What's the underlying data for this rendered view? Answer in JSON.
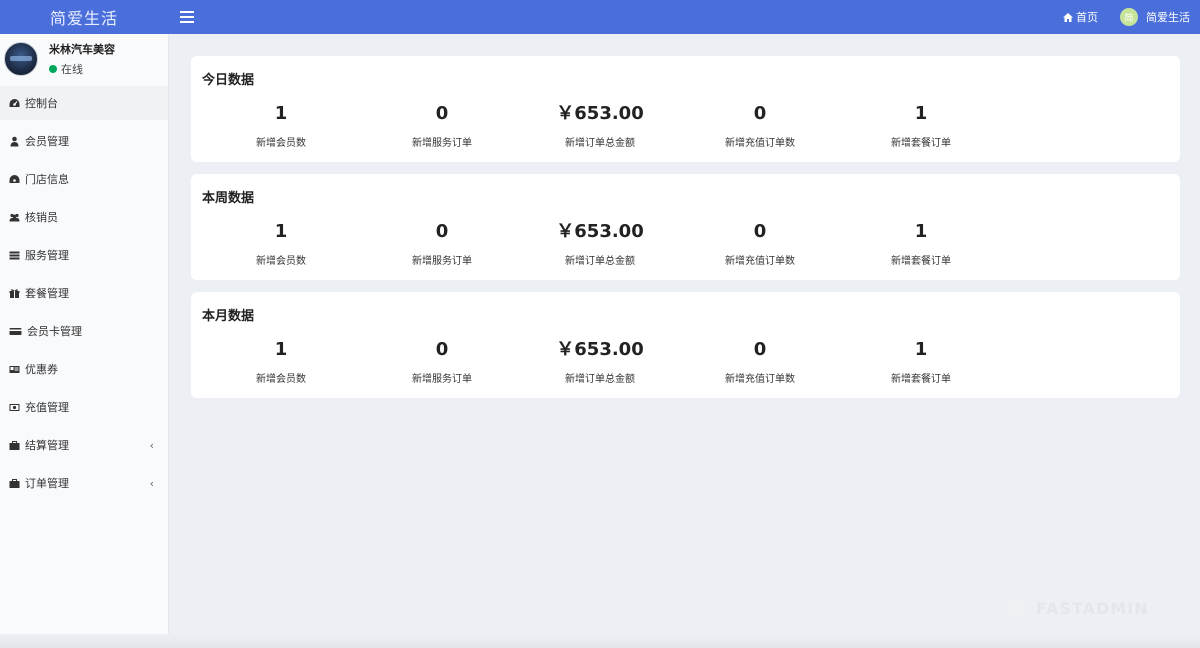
{
  "header": {
    "brand": "简爱生活",
    "home_label": "首页",
    "user_label": "简爱生活",
    "avatar_text": "简"
  },
  "user_panel": {
    "name": "米林汽车美容",
    "status": "在线"
  },
  "sidebar": {
    "items": [
      {
        "label": "控制台",
        "icon": "dashboard-icon"
      },
      {
        "label": "会员管理",
        "icon": "user-icon"
      },
      {
        "label": "门店信息",
        "icon": "store-icon"
      },
      {
        "label": "核销员",
        "icon": "users-icon"
      },
      {
        "label": "服务管理",
        "icon": "list-icon"
      },
      {
        "label": "套餐管理",
        "icon": "gift-icon"
      },
      {
        "label": "会员卡管理",
        "icon": "credit-card-icon"
      },
      {
        "label": "优惠券",
        "icon": "coupon-icon"
      },
      {
        "label": "充值管理",
        "icon": "money-icon"
      },
      {
        "label": "结算管理",
        "icon": "briefcase-icon"
      },
      {
        "label": "订单管理",
        "icon": "briefcase-icon"
      }
    ]
  },
  "cards": [
    {
      "title": "今日数据",
      "stats": [
        {
          "value": "1",
          "label": "新增会员数"
        },
        {
          "value": "0",
          "label": "新增服务订单"
        },
        {
          "value": "￥653.00",
          "label": "新增订单总金额"
        },
        {
          "value": "0",
          "label": "新增充值订单数"
        },
        {
          "value": "1",
          "label": "新增套餐订单"
        }
      ]
    },
    {
      "title": "本周数据",
      "stats": [
        {
          "value": "1",
          "label": "新增会员数"
        },
        {
          "value": "0",
          "label": "新增服务订单"
        },
        {
          "value": "￥653.00",
          "label": "新增订单总金额"
        },
        {
          "value": "0",
          "label": "新增充值订单数"
        },
        {
          "value": "1",
          "label": "新增套餐订单"
        }
      ]
    },
    {
      "title": "本月数据",
      "stats": [
        {
          "value": "1",
          "label": "新增会员数"
        },
        {
          "value": "0",
          "label": "新增服务订单"
        },
        {
          "value": "￥653.00",
          "label": "新增订单总金额"
        },
        {
          "value": "0",
          "label": "新增充值订单数"
        },
        {
          "value": "1",
          "label": "新增套餐订单"
        }
      ]
    }
  ],
  "watermark": "FASTADMIN",
  "colors": {
    "topbar": "#4a6fdb",
    "sidebar_bg": "#f9fafc",
    "content_bg": "#ecf0f5",
    "status_online": "#00a65a"
  }
}
